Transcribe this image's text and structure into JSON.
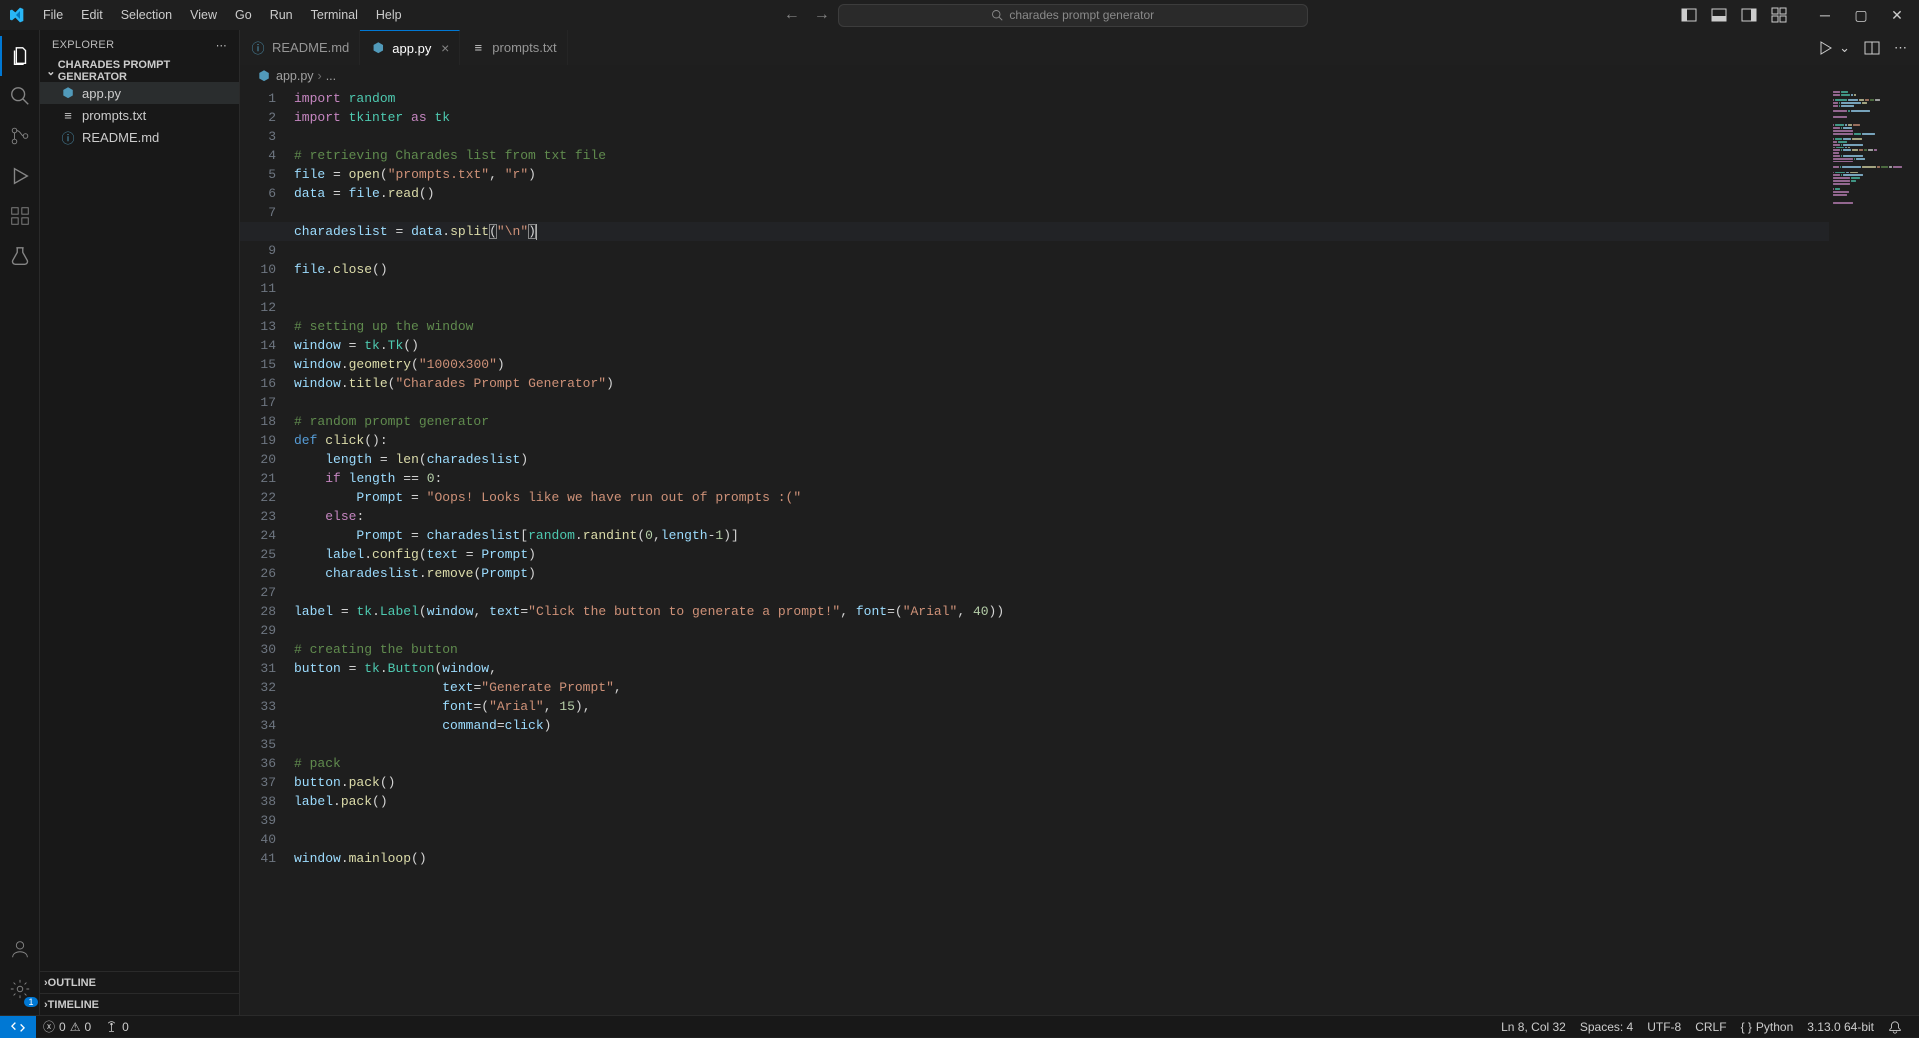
{
  "menu": [
    "File",
    "Edit",
    "Selection",
    "View",
    "Go",
    "Run",
    "Terminal",
    "Help"
  ],
  "search": {
    "placeholder": "charades prompt generator"
  },
  "sidebar": {
    "title": "EXPLORER",
    "project": "CHARADES PROMPT GENERATOR",
    "files": [
      {
        "name": "app.py",
        "icon": "python",
        "active": true
      },
      {
        "name": "prompts.txt",
        "icon": "text",
        "active": false
      },
      {
        "name": "README.md",
        "icon": "info",
        "active": false
      }
    ],
    "outline": "OUTLINE",
    "timeline": "TIMELINE"
  },
  "tabs": [
    {
      "label": "README.md",
      "icon": "info",
      "active": false
    },
    {
      "label": "app.py",
      "icon": "python",
      "active": true
    },
    {
      "label": "prompts.txt",
      "icon": "text",
      "active": false
    }
  ],
  "breadcrumb": {
    "file": "app.py",
    "sep": "›",
    "rest": "..."
  },
  "code": {
    "lines": 41,
    "activeLine": 8
  },
  "status": {
    "errors": "0",
    "warnings": "0",
    "ports": "0",
    "cursor": "Ln 8, Col 32",
    "spaces": "Spaces: 4",
    "encoding": "UTF-8",
    "eol": "CRLF",
    "lang": "Python",
    "interp": "3.13.0 64-bit"
  }
}
